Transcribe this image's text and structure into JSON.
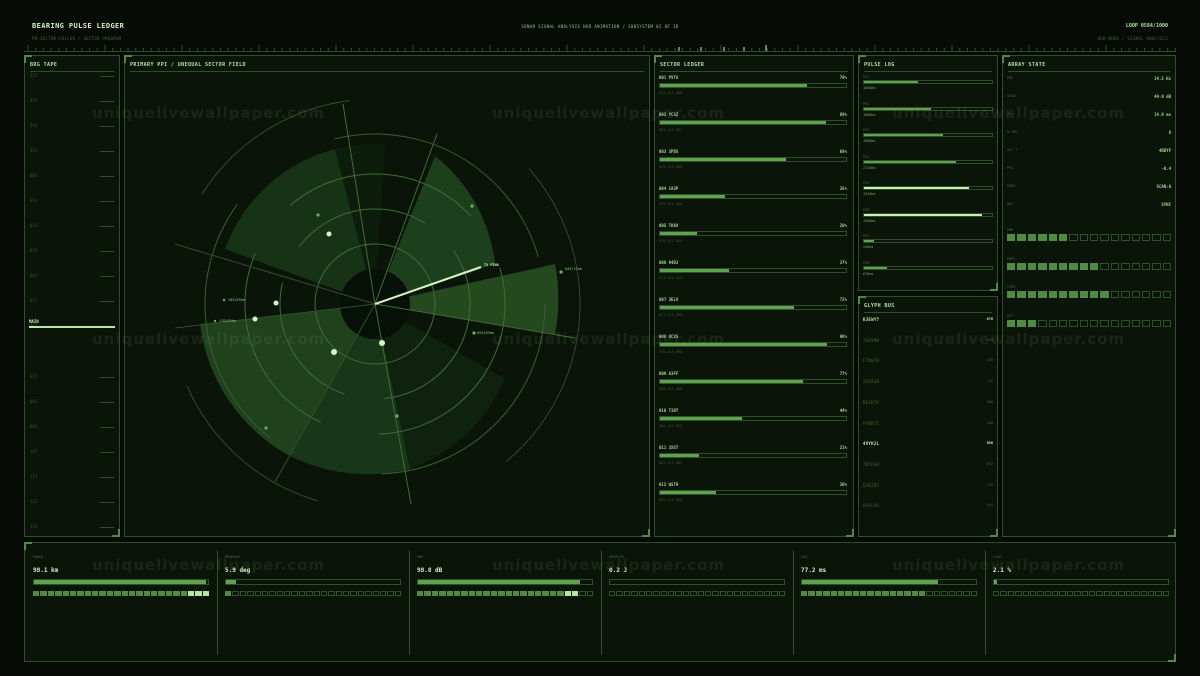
{
  "header": {
    "title": "BEARING PULSE LEDGER",
    "subtitle": "PR-SECTOR-CALLER / SECTOR PROGRAM",
    "caption": "SONAR SIGNAL ANALYSIS HUD ANIMATION  /  SUBSYSTEM 02 OF 18",
    "loop": "LOOP 0584/1000",
    "right_sub": "HUD NODE / SIGNAL ANALYSIS"
  },
  "brg_tape": {
    "title": "BRG TAPE",
    "ticks": [
      "321",
      "331",
      "341",
      "351",
      "001",
      "011",
      "021",
      "031",
      "041",
      "051",
      "061",
      "071",
      "081",
      "091",
      "101",
      "111",
      "121",
      "131",
      "141",
      "151",
      "161"
    ],
    "marker": "MAIN"
  },
  "ppi": {
    "title": "PRIMARY PPI  /  UNEQUAL SECTOR FIELD",
    "contacts": [
      "TX PING",
      "049/17km",
      "185/09km",
      "170/09km",
      "054/09km"
    ]
  },
  "ledger": {
    "title": "SECTOR LEDGER",
    "rows": [
      {
        "name": "001 PVTX",
        "pct": "79%",
        "value": 79,
        "sub": "075-111 080"
      },
      {
        "name": "002 YCSZ",
        "pct": "89%",
        "value": 89,
        "sub": "081-121 091"
      },
      {
        "name": "003 3PDS",
        "pct": "68%",
        "value": 68,
        "sub": "079-131 068"
      },
      {
        "name": "004 CA3P",
        "pct": "35%",
        "value": 35,
        "sub": "078-141 048"
      },
      {
        "name": "005 TKAX",
        "pct": "20%",
        "value": 20,
        "sub": "076-151 064"
      },
      {
        "name": "006 94DJ",
        "pct": "37%",
        "value": 37,
        "sub": "074-161 079"
      },
      {
        "name": "007 3ELV",
        "pct": "72%",
        "value": 72,
        "sub": "071-171 090"
      },
      {
        "name": "008 UCXS",
        "pct": "90%",
        "value": 90,
        "sub": "070-181 088"
      },
      {
        "name": "009 A3FF",
        "pct": "77%",
        "value": 77,
        "sub": "068-191 080"
      },
      {
        "name": "010 T3DT",
        "pct": "44%",
        "value": 44,
        "sub": "066-201 075"
      },
      {
        "name": "011 3XST",
        "pct": "21%",
        "value": 21,
        "sub": "064-211 084"
      },
      {
        "name": "012 WSTH",
        "pct": "30%",
        "value": 30,
        "sub": "062-221 090"
      }
    ]
  },
  "pulse_log": {
    "title": "PULSE LOG",
    "rows": [
      {
        "lbl": "P01",
        "value": 42,
        "ms": "1680ms"
      },
      {
        "lbl": "P02",
        "value": 52,
        "ms": "1880ms"
      },
      {
        "lbl": "P03",
        "value": 62,
        "ms": "1980ms"
      },
      {
        "lbl": "P04",
        "value": 72,
        "ms": "2720ms"
      },
      {
        "lbl": "P05",
        "value": 82,
        "ms": "1320ms"
      },
      {
        "lbl": "P06",
        "value": 92,
        "ms": "1360ms"
      },
      {
        "lbl": "P07",
        "value": 8,
        "ms": "240ms"
      },
      {
        "lbl": "P08",
        "value": 18,
        "ms": "670ms"
      }
    ]
  },
  "glyph_bus": {
    "title": "GLYPH BUS",
    "rows": [
      {
        "g": "K3EWY7",
        "n": "076",
        "hot": true
      },
      {
        "g": "7UDVM8",
        "n": "140",
        "hot": false
      },
      {
        "g": "FTN8ZH",
        "n": "220",
        "hot": false
      },
      {
        "g": "25XASB",
        "n": "142",
        "hot": false
      },
      {
        "g": "RK2KTV",
        "n": "060",
        "hot": false
      },
      {
        "g": "PFNR7C",
        "n": "188",
        "hot": false
      },
      {
        "g": "4VYK2L",
        "n": "056",
        "hot": true
      },
      {
        "g": "7D5PAN",
        "n": "092",
        "hot": false
      },
      {
        "g": "U3E2RS",
        "n": "135",
        "hot": false
      },
      {
        "g": "D9XLAD",
        "n": "444",
        "hot": false
      }
    ]
  },
  "array_state": {
    "title": "ARRAY STATE",
    "rows": [
      {
        "k": "PRF",
        "v": "14.5 Hz"
      },
      {
        "k": "GAIN",
        "v": "49.9 dB"
      },
      {
        "k": "TX",
        "v": "14.9 ms"
      },
      {
        "k": "N.TRK",
        "v": "8"
      },
      {
        "k": "SEL T",
        "v": "4RDYF"
      },
      {
        "k": "PHI",
        "v": "-0.4"
      },
      {
        "k": "MODE",
        "v": "SCAN-A"
      },
      {
        "k": "BUS",
        "v": "SYNC"
      }
    ],
    "levels": [
      {
        "k": "PWR",
        "on": 6
      },
      {
        "k": "PORT",
        "on": 9
      },
      {
        "k": "STBD",
        "on": 10
      },
      {
        "k": "AFT",
        "on": 3
      }
    ]
  },
  "metrics": [
    {
      "k": "RANGE",
      "v": "98.1 km",
      "value": 99,
      "on": 21,
      "hi": 3
    },
    {
      "k": "BEARING",
      "v": "5.9 deg",
      "value": 6,
      "on": 1,
      "hi": 0
    },
    {
      "k": "SNR",
      "v": "98.8 dB",
      "value": 93,
      "on": 20,
      "hi": 2
    },
    {
      "k": "DOPPLER",
      "v": "0.2 J",
      "value": 0,
      "on": 0,
      "hi": 0
    },
    {
      "k": "LAG",
      "v": "77.2 ms",
      "value": 78,
      "on": 17,
      "hi": 0
    },
    {
      "k": "LOAD",
      "v": "2.1 %",
      "value": 2,
      "on": 0,
      "hi": 0
    }
  ],
  "watermark": "uniquelivewallpaper.com"
}
